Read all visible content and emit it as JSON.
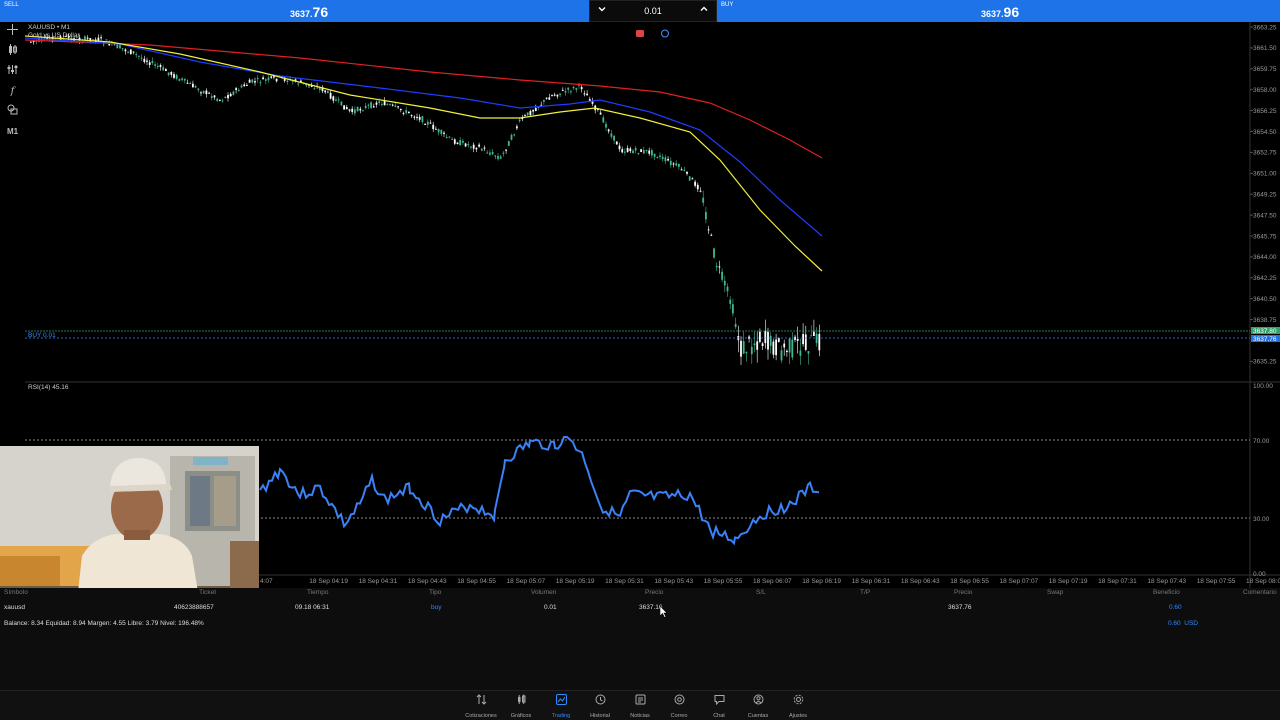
{
  "trade_bar": {
    "sell_label": "SELL",
    "sell_price_prefix": "3637.",
    "sell_price_big": "76",
    "buy_label": "BUY",
    "buy_price_prefix": "3637.",
    "buy_price_big": "96",
    "volume": "0.01",
    "volume_down_icon": "chevron-down-icon",
    "volume_up_icon": "chevron-up-icon"
  },
  "left_tools": [
    "crosshair-icon",
    "candles-icon",
    "indicators-icon",
    "function-icon",
    "objects-icon",
    "timeframe-label"
  ],
  "left_tools_timeframe": "M1",
  "chart": {
    "symbol_line": "XAUUSD • M1",
    "sub_line": "Gold vs US Dollar",
    "position_label": "BUY 0.01",
    "rsi_label": "RSI(14) 45.16",
    "price_ticks": [
      "3663.25",
      "3661.50",
      "3659.75",
      "3658.00",
      "3656.25",
      "3654.50",
      "3652.75",
      "3651.00",
      "3649.25",
      "3647.50",
      "3645.75",
      "3644.00",
      "3642.25",
      "3640.50",
      "3638.75",
      "3635.25"
    ],
    "price_tag_bid": "3637.80",
    "price_tag_line": "3637.76",
    "rsi_ticks": [
      "100.00",
      "70.00",
      "30.00",
      "0.00"
    ],
    "time_ticks": [
      "4:07",
      "18 Sep 04:19",
      "18 Sep 04:31",
      "18 Sep 04:43",
      "18 Sep 04:55",
      "18 Sep 05:07",
      "18 Sep 05:19",
      "18 Sep 05:31",
      "18 Sep 05:43",
      "18 Sep 05:55",
      "18 Sep 06:07",
      "18 Sep 06:19",
      "18 Sep 06:31",
      "18 Sep 06:43",
      "18 Sep 06:55",
      "18 Sep 07:07",
      "18 Sep 07:19",
      "18 Sep 07:31",
      "18 Sep 07:43",
      "18 Sep 07:55",
      "18 Sep 08:07"
    ],
    "colors": {
      "ma_slow": "#e02020",
      "ma_mid": "#1e3cff",
      "ma_fast": "#f0f03c",
      "rsi": "#3b82f6",
      "bull": "#3fb98f",
      "bear": "#ffffff"
    }
  },
  "table": {
    "headers": [
      "Símbolo",
      "Ticket",
      "Tiempo",
      "Tipo",
      "Volumen",
      "Precio",
      "S/L",
      "T/P",
      "Precio",
      "Swap",
      "Beneficio",
      "Comentario"
    ],
    "row": {
      "symbol": "xauusd",
      "ticket": "40623888657",
      "time": "09.18 06:31",
      "type": "buy",
      "volume": "0.01",
      "open_price": "3637.16",
      "current_price": "3637.76",
      "profit": "0.60"
    },
    "balance": "Balance: 8.34 Equidad: 8.94 Margen: 4.55 Libre: 3.79 Nivel: 196.48%",
    "profit_total": "0.60",
    "currency": "USD"
  },
  "nav": [
    {
      "label": "Cotizaciones",
      "icon": "quotes-icon"
    },
    {
      "label": "Gráficos",
      "icon": "charts-icon"
    },
    {
      "label": "Trading",
      "icon": "trading-icon",
      "active": true
    },
    {
      "label": "Historial",
      "icon": "history-icon"
    },
    {
      "label": "Noticias",
      "icon": "news-icon"
    },
    {
      "label": "Correo",
      "icon": "mail-icon"
    },
    {
      "label": "Chat",
      "icon": "chat-icon"
    },
    {
      "label": "Cuentas",
      "icon": "accounts-icon"
    },
    {
      "label": "Ajustes",
      "icon": "settings-icon"
    }
  ]
}
